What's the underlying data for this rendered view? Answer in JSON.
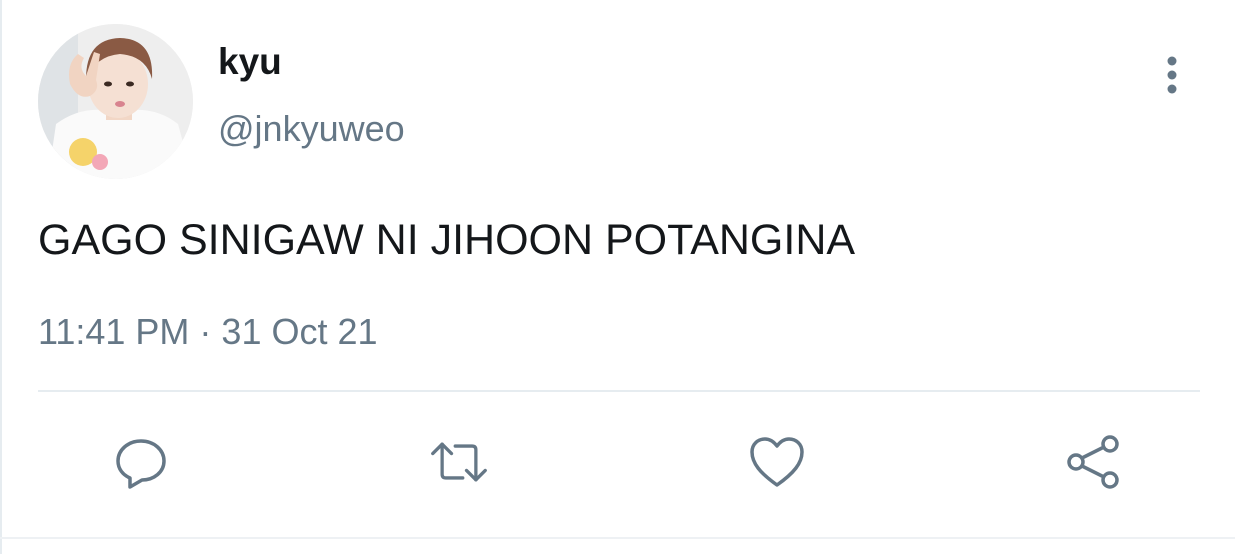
{
  "tweet": {
    "author": {
      "display_name": "kyu",
      "handle": "@jnkyuweo",
      "avatar_icon": "profile-photo"
    },
    "text": "GAGO SINIGAW NI JIHOON POTANGINA",
    "time": "11:41 PM",
    "separator": "·",
    "date": "31 Oct 21"
  },
  "menu": {
    "icon": "more-vertical-icon"
  },
  "actions": [
    {
      "name": "reply",
      "icon": "reply-icon"
    },
    {
      "name": "retweet",
      "icon": "retweet-icon"
    },
    {
      "name": "like",
      "icon": "heart-icon"
    },
    {
      "name": "share",
      "icon": "share-icon"
    }
  ],
  "colors": {
    "text": "#14171a",
    "secondary": "#657786",
    "divider": "#e6ecf0"
  }
}
